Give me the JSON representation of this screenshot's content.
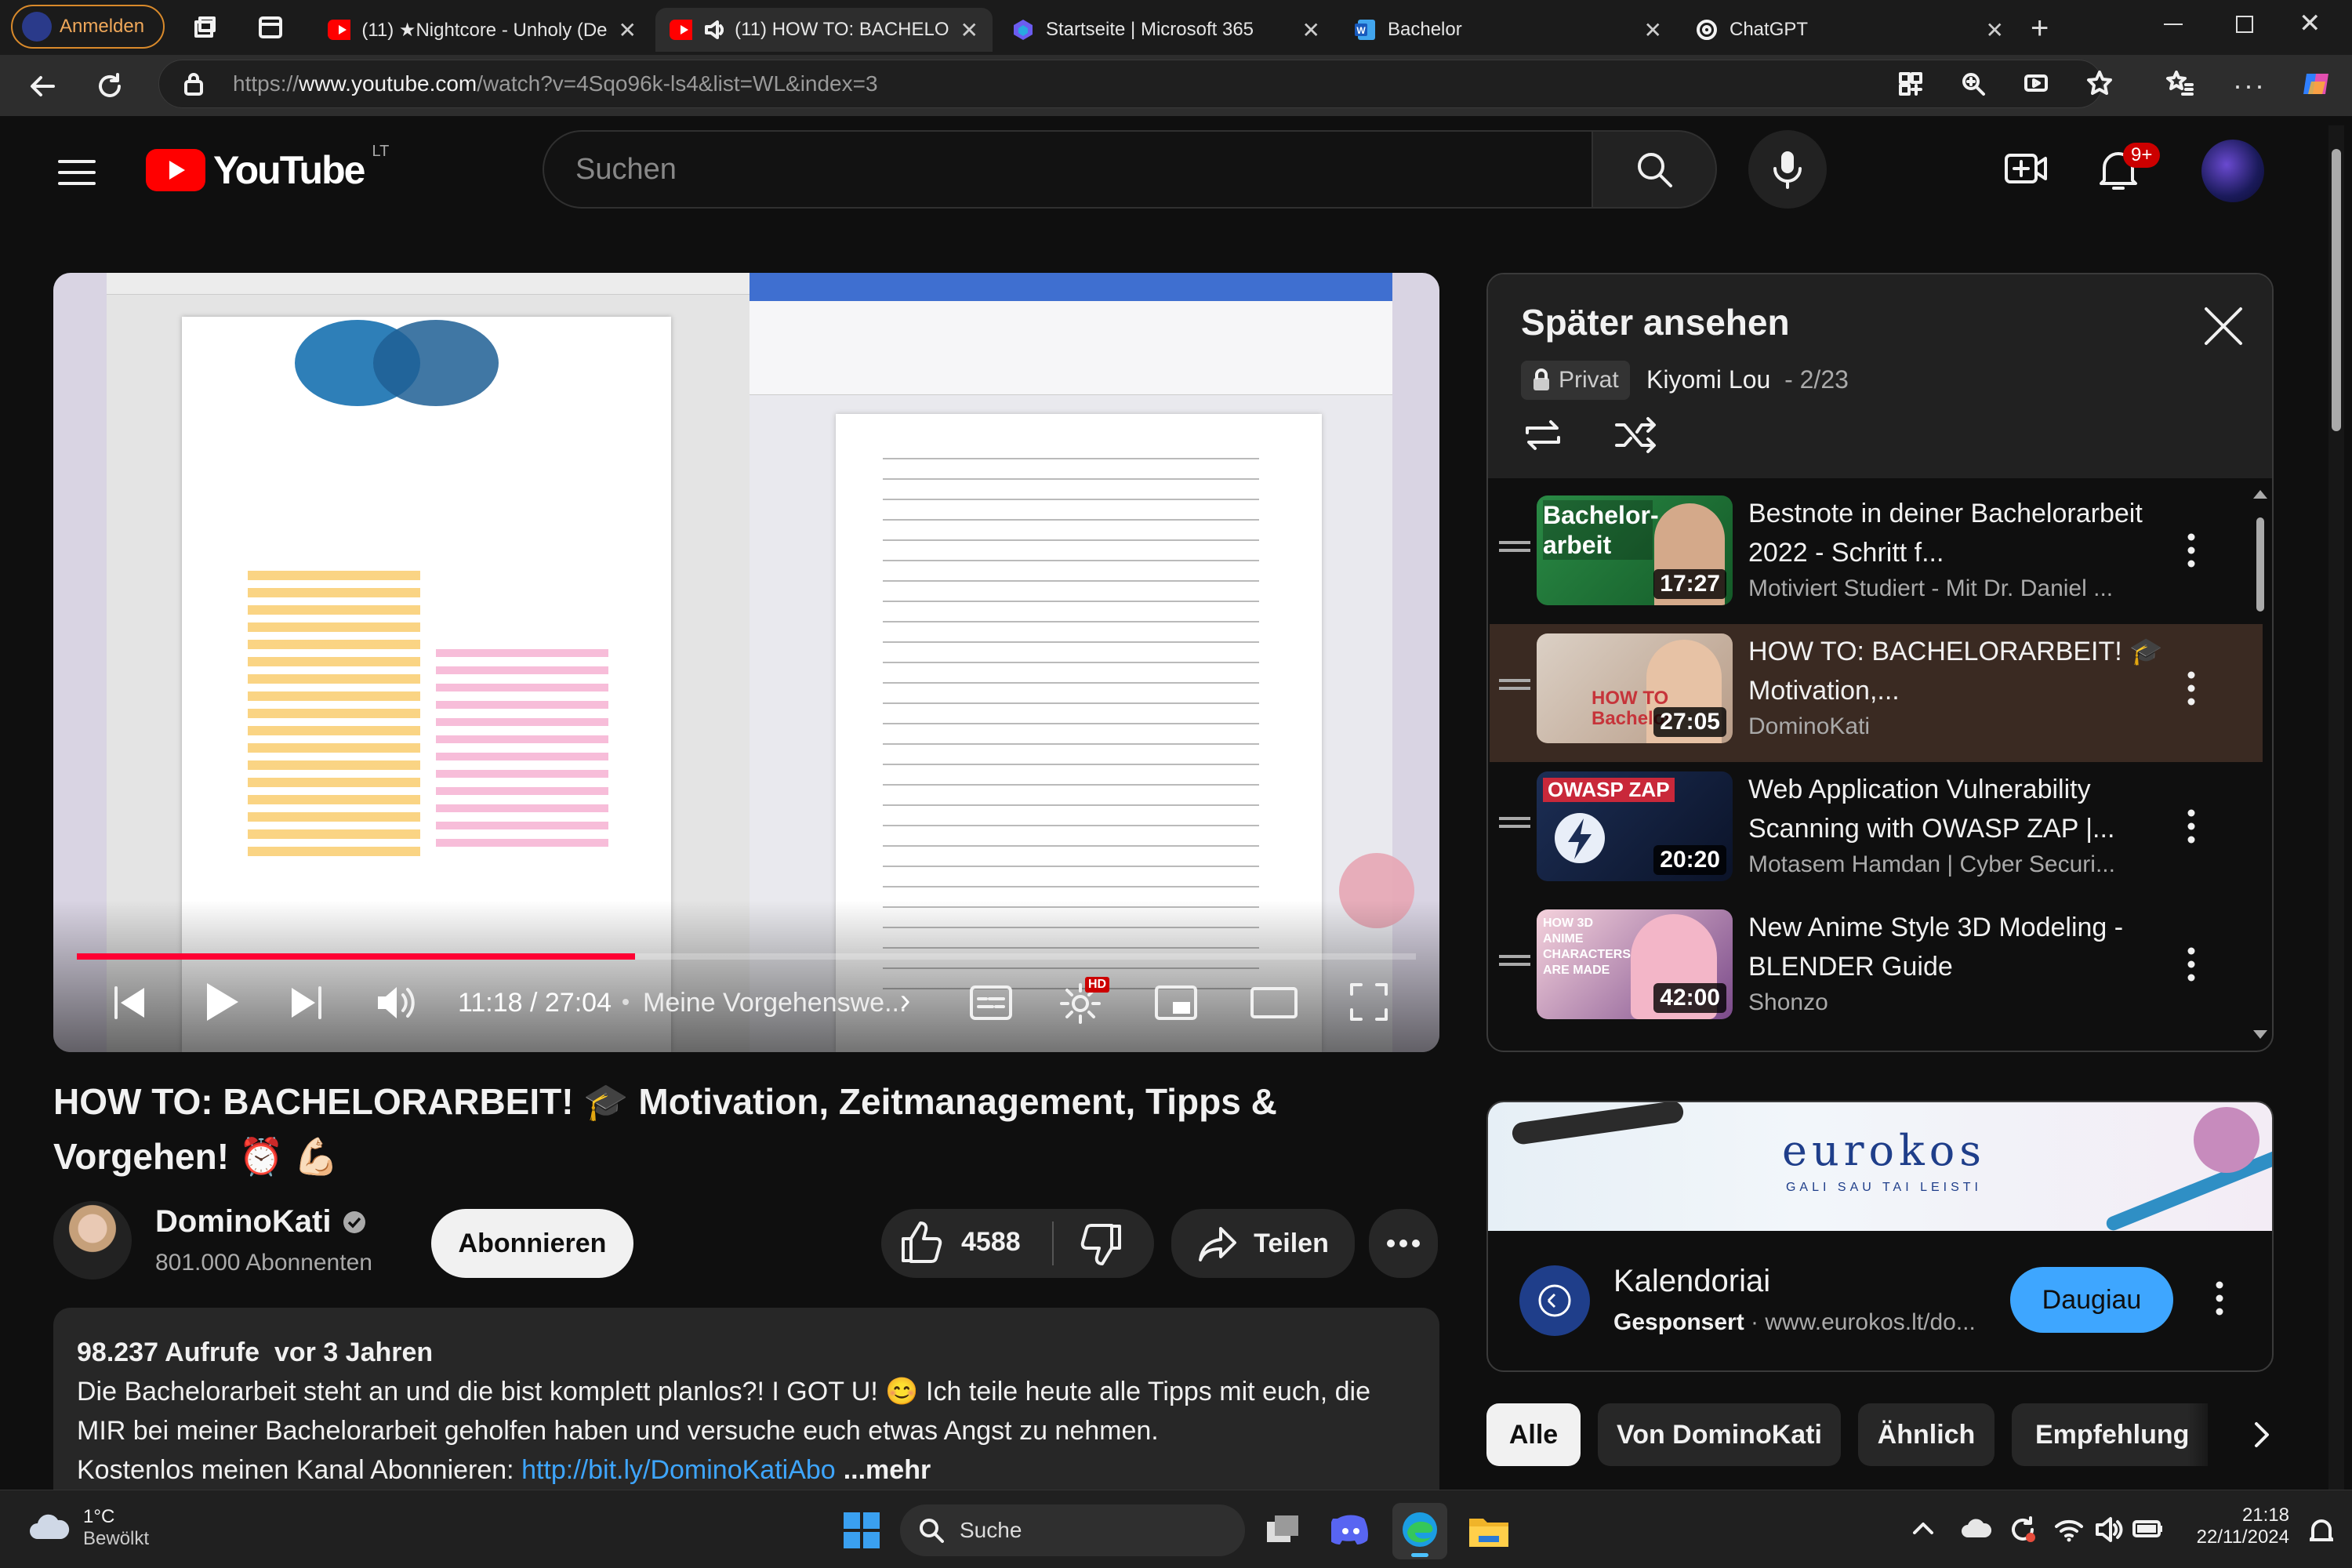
{
  "browser": {
    "profile_label": "Anmelden",
    "tabs": [
      {
        "title": "(11) ★Nightcore - Unholy (De",
        "icon": "youtube-icon"
      },
      {
        "title": "(11) HOW TO: BACHELO",
        "icon": "youtube-icon",
        "active": true,
        "audio": true
      },
      {
        "title": "Startseite | Microsoft 365",
        "icon": "microsoft365-icon"
      },
      {
        "title": "Bachelor",
        "icon": "word-icon"
      },
      {
        "title": "ChatGPT",
        "icon": "chatgpt-icon"
      }
    ],
    "url_prefix": "https://",
    "url_host": "www.youtube.com",
    "url_path": "/watch?v=4Sqo96k-ls4&list=WL&index=3"
  },
  "header": {
    "logo_text": "YouTube",
    "logo_country": "LT",
    "search_placeholder": "Suchen",
    "notification_count": "9+"
  },
  "player": {
    "time": "11:18 / 27:04",
    "chapter": "Meine Vorgehenswe...",
    "hd_badge": "HD",
    "progress": 0.417
  },
  "video": {
    "title": "HOW TO: BACHELORARBEIT! 🎓 Motivation, Zeitmanagement, Tipps & Vorgehen! ⏰ 💪🏻",
    "channel_name": "DominoKati",
    "subscribers": "801.000 Abonnenten",
    "subscribe_label": "Abonnieren",
    "like_count": "4588",
    "share_label": "Teilen",
    "views": "98.237 Aufrufe",
    "age": "vor 3 Jahren",
    "description_line1": "Die Bachelorarbeit steht an und die bist komplett planlos?! I GOT U! 😊 Ich teile heute alle Tipps mit euch, die",
    "description_line2": "MIR bei meiner Bachelorarbeit geholfen haben und versuche euch etwas Angst zu nehmen.",
    "description_line3_text": "Kostenlos meinen Kanal Abonnieren: ",
    "description_link": "http://bit.ly/DominoKatiAbo",
    "more_label": "...mehr"
  },
  "playlist": {
    "title": "Später ansehen",
    "privacy": "Privat",
    "owner": "Kiyomi Lou",
    "position": "2/23",
    "items": [
      {
        "title": "Bestnote in deiner Bachelorarbeit 2022 - Schritt f...",
        "channel": "Motiviert Studiert - Mit Dr. Daniel ...",
        "duration": "17:27",
        "thumb_text": "Bachelor-arbeit",
        "thumb_color": "#1e7a3a"
      },
      {
        "title": "HOW TO: BACHELORARBEIT! 🎓 Motivation,...",
        "channel": "DominoKati",
        "duration": "27:05",
        "thumb_text": "HOW TO Bachelor",
        "thumb_color": "#c9a88b",
        "active": true
      },
      {
        "title": "Web Application Vulnerability Scanning with OWASP ZAP |...",
        "channel": "Motasem Hamdan | Cyber Securi...",
        "duration": "20:20",
        "thumb_text": "OWASP ZAP",
        "thumb_color": "#1b2a4a"
      },
      {
        "title": "New Anime Style 3D Modeling - BLENDER Guide",
        "channel": "Shonzo",
        "duration": "42:00",
        "thumb_text": "HOW 3D ANIME CHARACTERS ARE MADE",
        "thumb_color": "#3a2a4a"
      }
    ]
  },
  "ad": {
    "brand": "eurokos",
    "tagline": "GALI SAU TAI LEISTI",
    "title": "Kalendoriai",
    "sponsored": "Gesponsert",
    "domain": "www.eurokos.lt/do...",
    "cta": "Daugiau"
  },
  "chips": [
    "Alle",
    "Von DominoKati",
    "Ähnlich",
    "Empfehlung"
  ],
  "taskbar": {
    "temp": "1°C",
    "weather": "Bewölkt",
    "search": "Suche",
    "time": "21:18",
    "date": "22/11/2024"
  }
}
